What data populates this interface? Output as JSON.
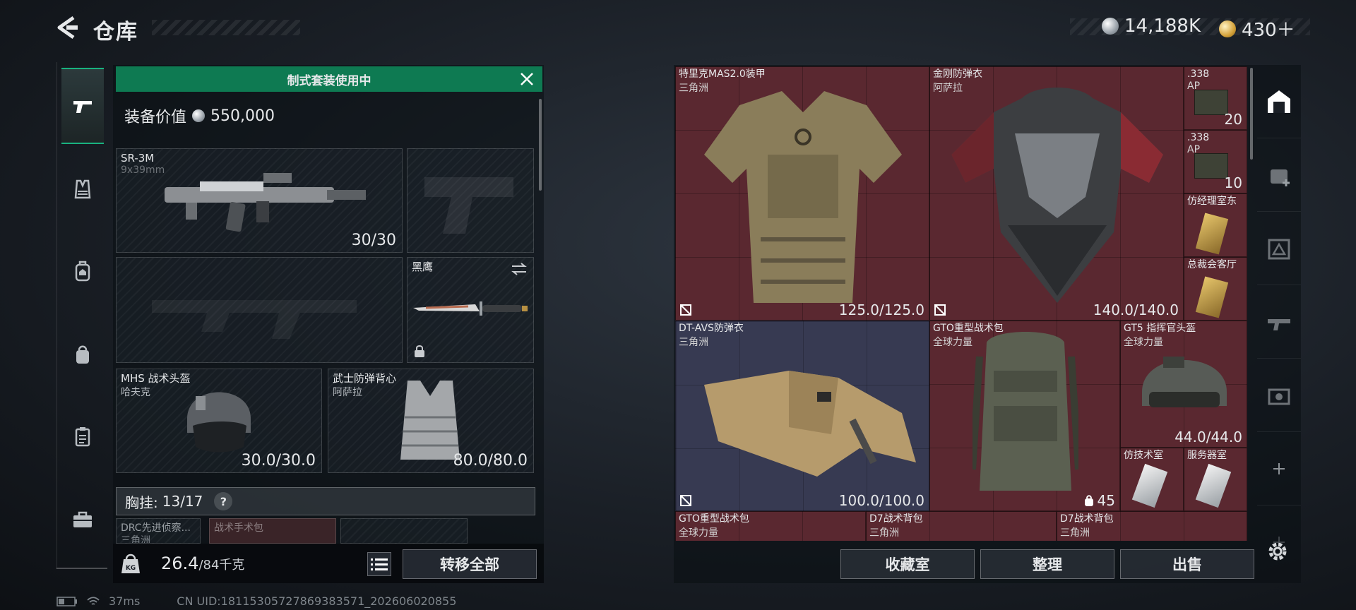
{
  "header": {
    "title": "仓库",
    "currency_silver": "14,188K",
    "currency_gold": "430＋"
  },
  "loadout": {
    "banner": "制式套装使用中",
    "equip_value_label": "装备价值",
    "equip_value": "550,000",
    "primary": {
      "name": "SR-3M",
      "ammo": "9x39mm",
      "count": "30/30"
    },
    "melee": {
      "name": "黑鹰"
    },
    "helmet": {
      "name": "MHS 战术头盔",
      "maker": "哈夫克",
      "durability": "30.0/30.0"
    },
    "armor": {
      "name": "武士防弹背心",
      "maker": "阿萨拉",
      "durability": "80.0/80.0"
    },
    "chest_rig": {
      "label": "胸挂:",
      "capacity": "13/17",
      "help": "?"
    },
    "rig_items": [
      {
        "name": "DRC先进侦察...",
        "maker": "三角洲"
      },
      {
        "name": "战术手术包",
        "maker": ""
      }
    ],
    "weight": "26.4",
    "weight_max": "/84千克",
    "transfer_all": "转移全部"
  },
  "storage": {
    "items": [
      {
        "name": "特里克MAS2.0装甲",
        "maker": "三角洲",
        "value": "125.0/125.0"
      },
      {
        "name": "金刚防弹衣",
        "maker": "阿萨拉",
        "value": "140.0/140.0"
      },
      {
        "name": ".338",
        "maker": "AP",
        "value": "20"
      },
      {
        "name": ".338",
        "maker": "AP",
        "value": "10"
      },
      {
        "name": "仿经理室东",
        "maker": "",
        "value": ""
      },
      {
        "name": "总裁会客厅",
        "maker": "",
        "value": ""
      },
      {
        "name": "DT-AVS防弹衣",
        "maker": "三角洲",
        "value": "100.0/100.0"
      },
      {
        "name": "GTO重型战术包",
        "maker": "全球力量",
        "value": "45"
      },
      {
        "name": "GT5 指挥官头盔",
        "maker": "全球力量",
        "value": "44.0/44.0"
      },
      {
        "name": "仿技术室",
        "maker": "",
        "value": ""
      },
      {
        "name": "服务器室",
        "maker": "",
        "value": ""
      },
      {
        "name": "GTO重型战术包",
        "maker": "全球力量",
        "value": ""
      },
      {
        "name": "D7战术背包",
        "maker": "三角洲",
        "value": ""
      },
      {
        "name": "D7战术背包",
        "maker": "三角洲",
        "value": ""
      }
    ],
    "buttons": {
      "collection": "收藏室",
      "organize": "整理",
      "sell": "出售"
    }
  },
  "status": {
    "ping": "37ms",
    "uid": "CN UID:18115305727869383571_202606020855"
  },
  "colors": {
    "accent": "#0e7a52",
    "grid_red": "#5a2830",
    "grid_blue": "#373a52"
  }
}
